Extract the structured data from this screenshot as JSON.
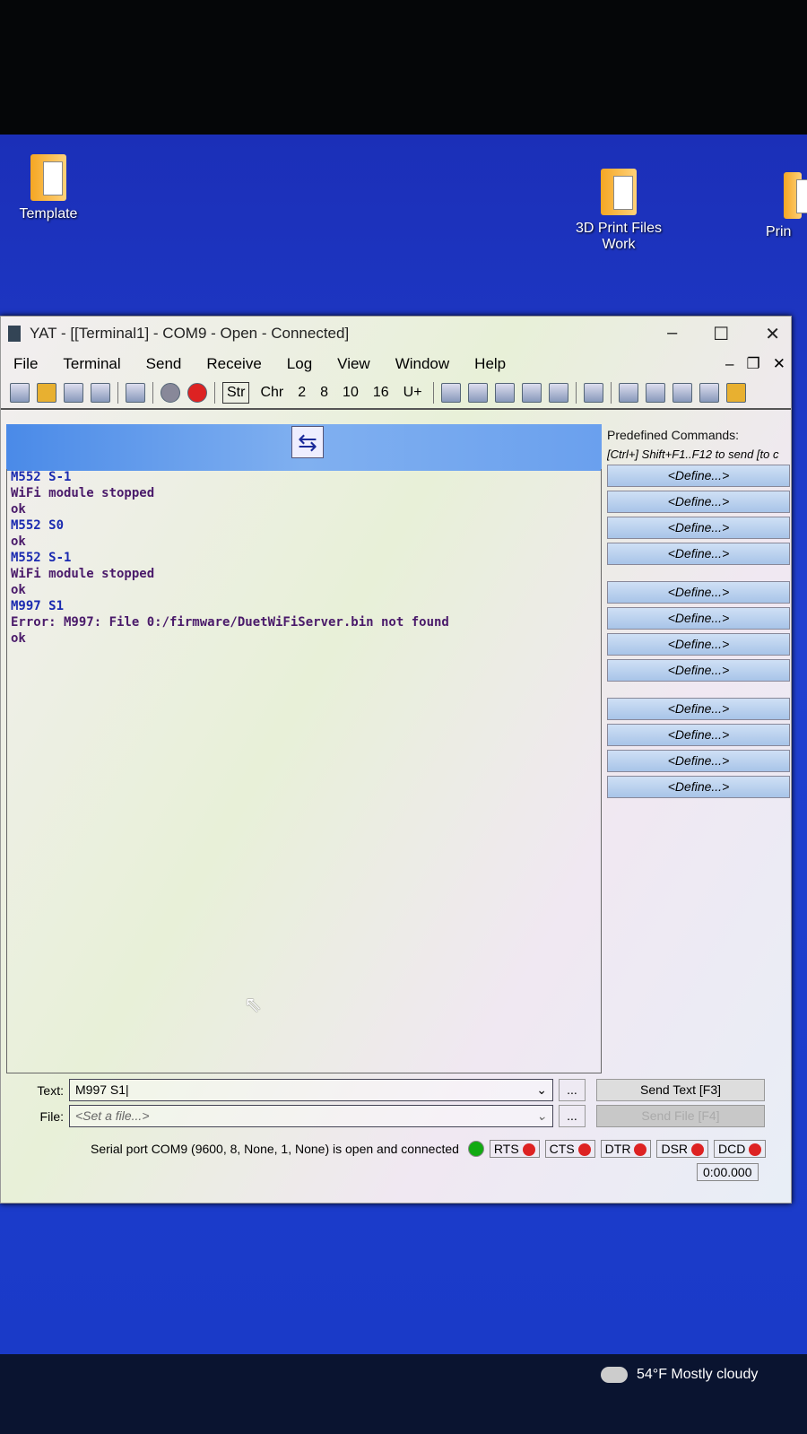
{
  "desktop": {
    "icons": [
      "Template",
      "3D Print Files Work",
      "Prin"
    ]
  },
  "window": {
    "title": "YAT - [[Terminal1] - COM9 - Open - Connected]"
  },
  "menu": [
    "File",
    "Terminal",
    "Send",
    "Receive",
    "Log",
    "View",
    "Window",
    "Help"
  ],
  "toolbar": {
    "radix": [
      "Str",
      "Chr",
      "2",
      "8",
      "10",
      "16",
      "U+"
    ],
    "selected": "Str"
  },
  "terminal": {
    "lines": [
      {
        "t": "M552 S-1",
        "dir": "tx"
      },
      {
        "t": "WiFi module stopped",
        "dir": "rx"
      },
      {
        "t": "ok",
        "dir": "rx"
      },
      {
        "t": "M552 S0",
        "dir": "tx"
      },
      {
        "t": "ok",
        "dir": "rx"
      },
      {
        "t": "M552 S-1",
        "dir": "tx"
      },
      {
        "t": "WiFi module stopped",
        "dir": "rx"
      },
      {
        "t": "ok",
        "dir": "rx"
      },
      {
        "t": "M997 S1",
        "dir": "tx"
      },
      {
        "t": "Error: M997: File 0:/firmware/DuetWiFiServer.bin not found",
        "dir": "rx"
      },
      {
        "t": "ok",
        "dir": "rx"
      }
    ]
  },
  "predefined": {
    "title": "Predefined Commands:",
    "subtitle": "[Ctrl+] Shift+F1..F12 to send [to c",
    "button": "<Define...>",
    "count": 12
  },
  "send": {
    "text_label": "Text:",
    "text_value": "M997 S1",
    "file_label": "File:",
    "file_placeholder": "<Set a file...>",
    "more": "...",
    "send_text": "Send Text [F3]",
    "send_file": "Send File [F4]"
  },
  "status": {
    "message": "Serial port COM9 (9600, 8, None, 1, None) is open and connected",
    "pins": [
      "RTS",
      "CTS",
      "DTR",
      "DSR",
      "DCD"
    ],
    "timer": "0:00.000"
  },
  "taskbar": {
    "weather": "54°F  Mostly cloudy"
  }
}
